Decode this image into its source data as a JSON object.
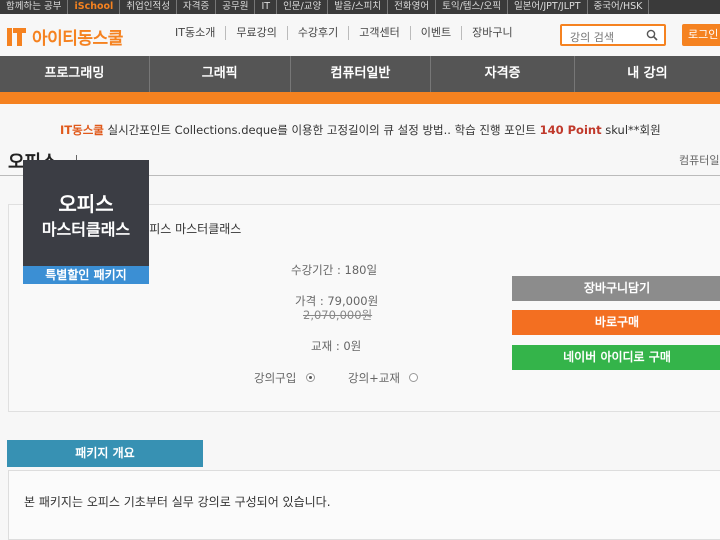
{
  "top_strip": {
    "items": [
      "함께하는 공부",
      "iSchool",
      "취업인적성",
      "자격증",
      "공무원",
      "IT",
      "인문/교양",
      "발음/스피치",
      "전화영어",
      "토익/텝스/오픽",
      "일본어/JPT/JLPT",
      "중국어/HSK"
    ]
  },
  "header": {
    "logo_text": "아이티동스쿨",
    "nav": [
      "IT동소개",
      "무료강의",
      "수강후기",
      "고객센터",
      "이벤트",
      "장바구니"
    ],
    "search_placeholder": "강의 검색",
    "login_label": "로그인"
  },
  "gnb": {
    "items": [
      "프로그래밍",
      "그래픽",
      "컴퓨터일반",
      "자격증",
      "내 강의"
    ]
  },
  "ticker": {
    "brand": "IT동스쿨",
    "message": "실시간포인트 Collections.deque를 이용한 고정길이의 큐 설정 방법.. 학습 진행 포인트",
    "points": "140 Point",
    "tail": "skul**회원"
  },
  "page": {
    "title": "오피스",
    "breadcrumb": "컴퓨터일반"
  },
  "package": {
    "name_label": "패키지명 : [특별할인] 오피스 마스터클래스",
    "thumb_line1": "오피스",
    "thumb_line2": "마스터클래스",
    "thumb_badge": "특별할인 패키지",
    "period": "수강기간 : 180일",
    "price": "가격 : 79,000원",
    "original_price": "2,070,000원",
    "material": "교재 : 0원",
    "option_lecture": "강의구입",
    "option_lecture_material": "강의+교재",
    "btn_cart": "장바구니담기",
    "btn_buy": "바로구매",
    "btn_naver": "네이버 아이디로 구매"
  },
  "overview": {
    "tab_label": "패키지 개요",
    "description": "본 패키지는 오피스 기초부터 실무 강의로 구성되어 있습니다."
  },
  "colors": {
    "brand_orange": "#f58220",
    "gnb_gray": "#555555",
    "cart_gray": "#8c8c8c",
    "buy_orange": "#f36f21",
    "naver_green": "#34b44a",
    "badge_blue": "#3b8fd4",
    "overview_blue": "#3791b3"
  }
}
